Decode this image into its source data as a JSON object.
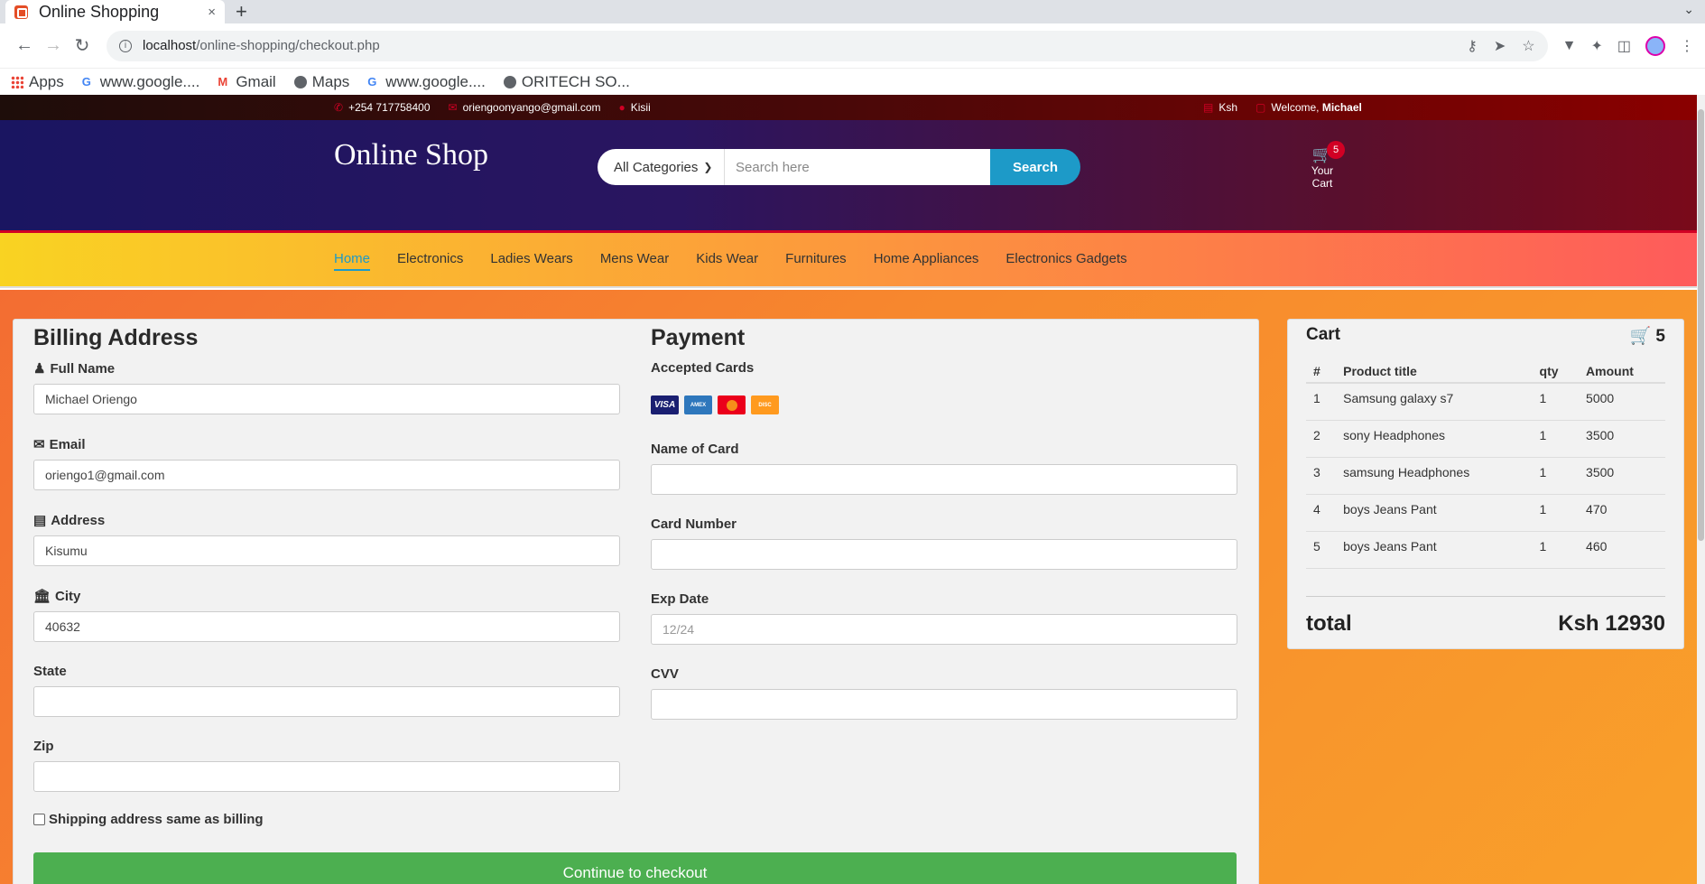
{
  "browser": {
    "tab_title": "Online Shopping",
    "tab_close": "×",
    "new_tab": "+",
    "url_host": "localhost",
    "url_path": "/online-shopping/checkout.php",
    "bookmarks": [
      "Apps",
      "www.google....",
      "Gmail",
      "Maps",
      "www.google....",
      "ORITECH SO..."
    ]
  },
  "topbar": {
    "phone": "+254 717758400",
    "email": "oriengoonyango@gmail.com",
    "location": "Kisii",
    "currency": "Ksh",
    "welcome": "Welcome, ",
    "user": "Michael"
  },
  "header": {
    "logo": "Online Shop",
    "category": "All Categories",
    "search_placeholder": "Search here",
    "search_button": "Search",
    "cart_count": "5",
    "cart_label": "Your Cart"
  },
  "nav": [
    "Home",
    "Electronics",
    "Ladies Wears",
    "Mens Wear",
    "Kids Wear",
    "Furnitures",
    "Home Appliances",
    "Electronics Gadgets"
  ],
  "billing": {
    "title": "Billing Address",
    "full_name_label": "Full Name",
    "full_name": "Michael Oriengo",
    "email_label": "Email",
    "email": "oriengo1@gmail.com",
    "address_label": "Address",
    "address": "Kisumu",
    "city_label": "City",
    "city": "40632",
    "state_label": "State",
    "state": "",
    "zip_label": "Zip",
    "zip": "",
    "shipping_same": "Shipping address same as billing"
  },
  "payment": {
    "title": "Payment",
    "accepted_cards": "Accepted Cards",
    "cards": [
      "VISA",
      "AMERICAN EXPRESS",
      "MASTERCARD",
      "DISCOVER"
    ],
    "name_label": "Name of Card",
    "card_number_label": "Card Number",
    "exp_label": "Exp Date",
    "exp_placeholder": "12/24",
    "cvv_label": "CVV"
  },
  "checkout_button": "Continue to checkout",
  "cart": {
    "title": "Cart",
    "count": "5",
    "columns": [
      "#",
      "Product title",
      "qty",
      "Amount"
    ],
    "rows": [
      [
        "1",
        "Samsung galaxy s7",
        "1",
        "5000"
      ],
      [
        "2",
        "sony Headphones",
        "1",
        "3500"
      ],
      [
        "3",
        "samsung Headphones",
        "1",
        "3500"
      ],
      [
        "4",
        "boys Jeans Pant",
        "1",
        "470"
      ],
      [
        "5",
        "boys Jeans Pant",
        "1",
        "460"
      ]
    ],
    "total_label": "total",
    "total_value": "Ksh 12930"
  },
  "colors": {
    "accent_red": "#d10024",
    "search_blue": "#1d9ac8",
    "checkout_green": "#4caf50"
  }
}
